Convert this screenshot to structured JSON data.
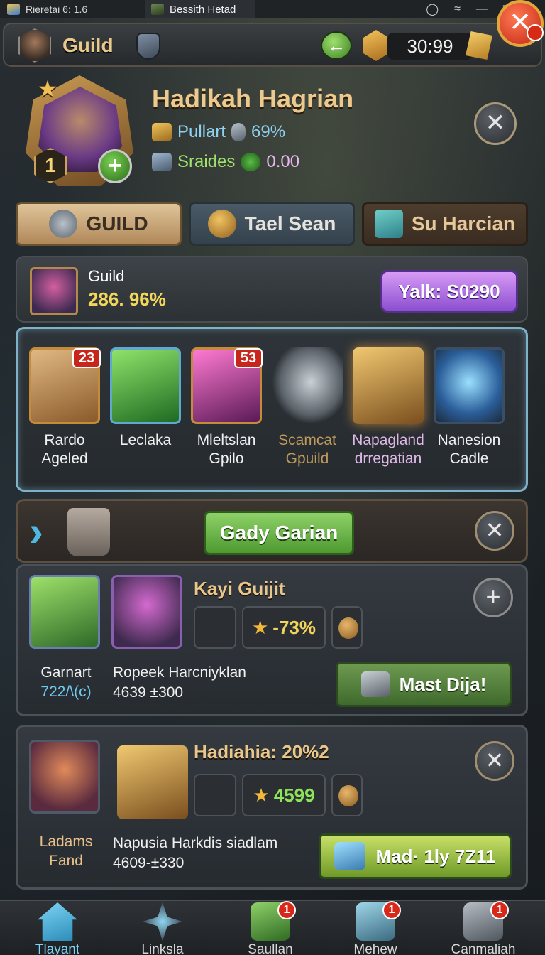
{
  "window": {
    "tab1_title": "Rieretai 6: 1.6",
    "tab2_title": "Bessith Hetad"
  },
  "topbar": {
    "title": "Guild",
    "timer": "30:99"
  },
  "profile": {
    "name": "Hadikah Hagrian",
    "level": "1",
    "stat1_label": "Pullart",
    "stat1_value": "69%",
    "stat2_label": "Sraides",
    "stat2_value": "0.00"
  },
  "tabs": [
    {
      "label": "GUILD"
    },
    {
      "label": "Tael Sean"
    },
    {
      "label": "Su Harcian"
    }
  ],
  "guild_info": {
    "label": "Guild",
    "percent": "286. 96%",
    "button": "Yalk: S0290"
  },
  "items": [
    {
      "name_line1": "Rardo",
      "name_line2": "Ageled",
      "badge": "23",
      "color": "#f0f0f0"
    },
    {
      "name_line1": "Leclaka",
      "name_line2": "",
      "badge": "",
      "color": "#f0f0f0"
    },
    {
      "name_line1": "Mleltslan",
      "name_line2": "Gpilo",
      "badge": "53",
      "color": "#f0f0f0"
    },
    {
      "name_line1": "Scamcat",
      "name_line2": "Gpuild",
      "badge": "",
      "color": "#c09a5a"
    },
    {
      "name_line1": "Napagland",
      "name_line2": "drregatian",
      "badge": "",
      "color": "#e0b8e8"
    },
    {
      "name_line1": "Nanesion",
      "name_line2": "Cadle",
      "badge": "",
      "color": "#f0f0f0"
    }
  ],
  "gady": {
    "button": "Gady Garian"
  },
  "members": [
    {
      "title": "Kayi Guijit",
      "stat_value": "-73%",
      "left_name_line1": "Garnart",
      "left_name_line2": "722/\\(c)",
      "desc_line1": "Ropeek Harcniyklan",
      "desc_line2": "4639 ±300",
      "button": "Mast Dija!"
    },
    {
      "title": "Hadiahia: 20%2",
      "stat_value": "4599",
      "left_name_line1": "Ladams",
      "left_name_line2": "Fand",
      "desc_line1": "Napusia Harkdis siadlam",
      "desc_line2": "4609-±330",
      "button": "Mad· 1ly 7Z11"
    }
  ],
  "bottom_nav": [
    {
      "label": "Tlayant",
      "badge": ""
    },
    {
      "label": "Linksla",
      "badge": ""
    },
    {
      "label": "Saullan",
      "badge": "1"
    },
    {
      "label": "Mehew",
      "badge": "1"
    },
    {
      "label": "Canmaliah",
      "badge": "1"
    }
  ]
}
